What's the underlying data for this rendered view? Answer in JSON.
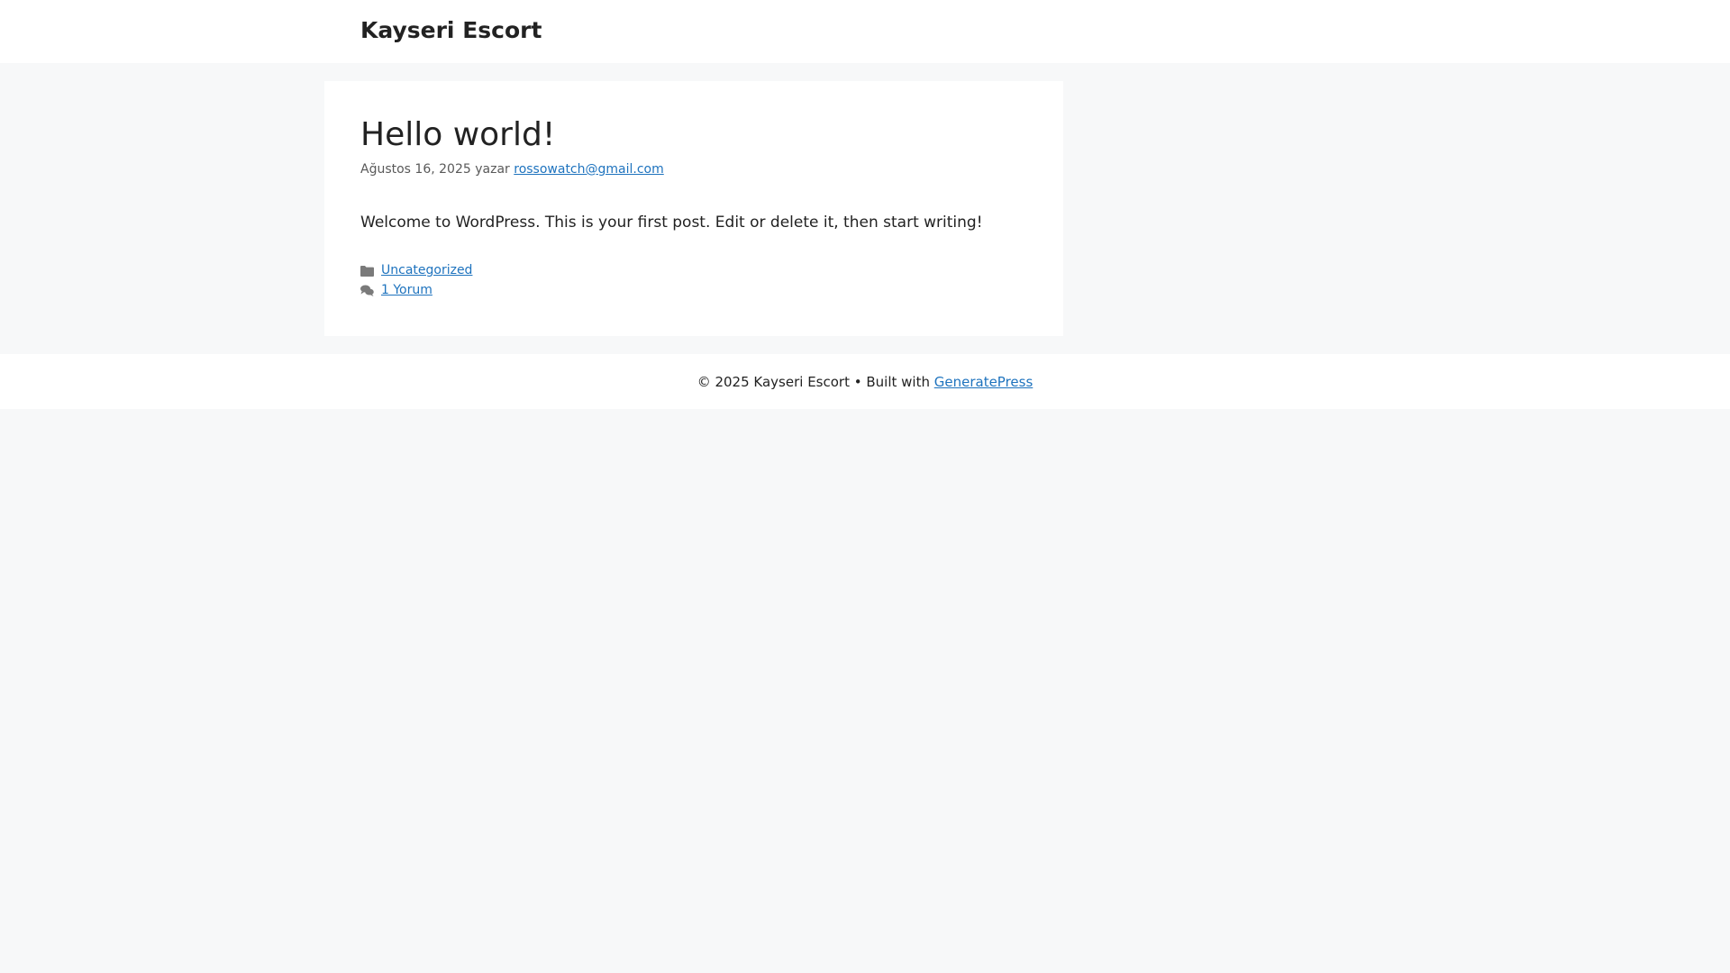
{
  "header": {
    "site_title": "Kayseri Escort"
  },
  "post": {
    "title": "Hello world!",
    "date": "Ağustos 16, 2025",
    "byline_word": "yazar",
    "author": "rossowatch@gmail.com",
    "content": "Welcome to WordPress. This is your first post. Edit or delete it, then start writing!",
    "category": "Uncategorized",
    "comments": "1 Yorum"
  },
  "footer": {
    "copyright": "© 2025 Kayseri Escort • Built with",
    "builder_link": "GeneratePress"
  },
  "icons": {
    "category": "folder-icon",
    "comments": "comments-icon"
  },
  "colors": {
    "link": "#1e73be",
    "page_background": "#f7f8f9",
    "card_background": "#ffffff",
    "text": "#222222",
    "meta_text": "#595959"
  }
}
